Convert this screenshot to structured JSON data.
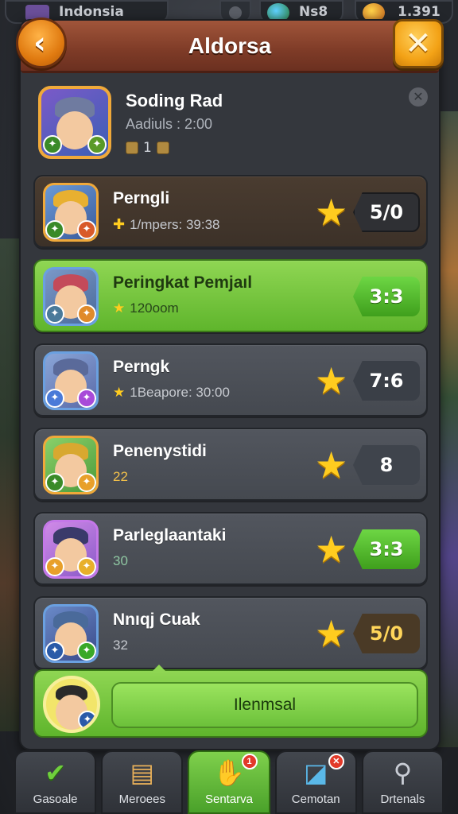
{
  "hud": {
    "region_label": "Indonsia",
    "gems_label": "Ns8",
    "coins_label": "1.391"
  },
  "panel": {
    "title": "Aldorsa",
    "back_icon": "chevron-left-icon",
    "close_icon": "close-icon"
  },
  "profile": {
    "name": "Soding Rad",
    "subtitle": "Aadiuls : 2:00",
    "stat": "1",
    "info_icon": "close-icon"
  },
  "rows": [
    {
      "name": "Perngli",
      "meta": "1/mpers: 39:38",
      "score": "5/0",
      "style": "brown",
      "meta_icon": "puzzle-icon"
    },
    {
      "name": "Peringkat Pemjaıl",
      "meta": "120oom",
      "score": "3:3",
      "style": "green",
      "meta_icon": "star-icon"
    },
    {
      "name": "Perngk",
      "meta": "1Beapore: 30:00",
      "score": "7:6",
      "style": "gray",
      "meta_icon": "star-icon"
    },
    {
      "name": "Penenystidi",
      "meta": "22",
      "score": "8",
      "style": "gray",
      "meta_icon": ""
    },
    {
      "name": "Parleglaantaki",
      "meta": "30",
      "score": "3:3",
      "style": "gray",
      "meta_icon": ""
    },
    {
      "name": "Nnıqj Cuak",
      "meta": "32",
      "score": "5/0",
      "style": "gray",
      "meta_icon": ""
    }
  ],
  "me": {
    "button_label": "Ilenmsal"
  },
  "nav": [
    {
      "label": "Gasoale",
      "icon": "checkmark-icon",
      "active": false
    },
    {
      "label": "Meroees",
      "icon": "book-icon",
      "active": false
    },
    {
      "label": "Sentarva",
      "icon": "hand-icon",
      "active": true,
      "badge": "1"
    },
    {
      "label": "Cemotan",
      "icon": "chart-icon",
      "active": false
    },
    {
      "label": "Drtenals",
      "icon": "search-icon",
      "active": false
    }
  ],
  "colors": {
    "title_bar": "#8a4430",
    "green_row": "#6fc03c",
    "accent_orange": "#f3a216",
    "star": "#ffcc1f"
  }
}
